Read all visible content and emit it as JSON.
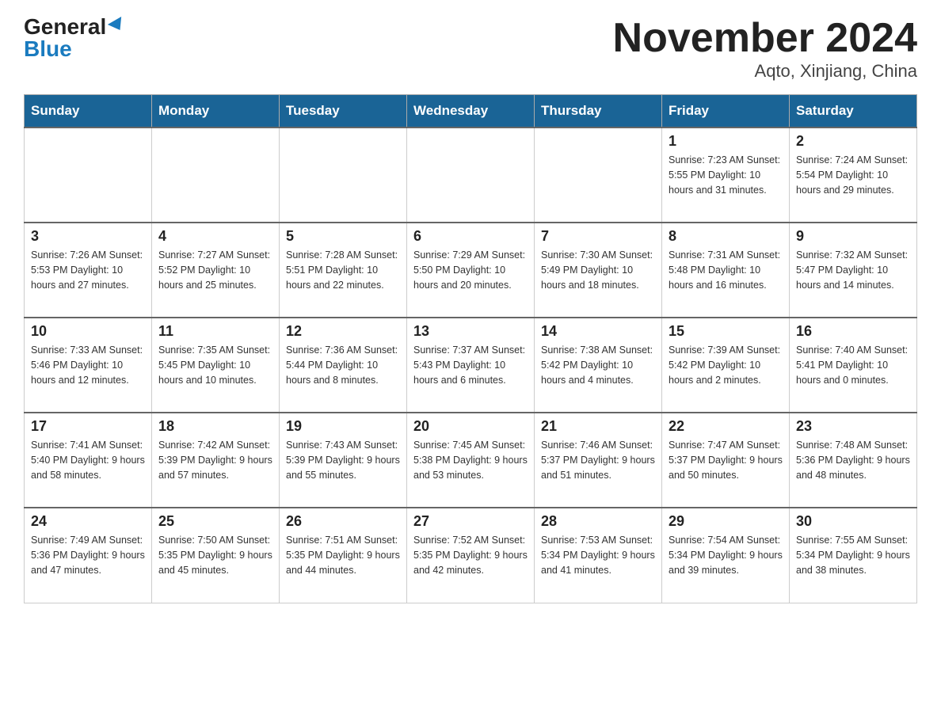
{
  "logo": {
    "general": "General",
    "blue": "Blue"
  },
  "title": "November 2024",
  "subtitle": "Aqto, Xinjiang, China",
  "days_of_week": [
    "Sunday",
    "Monday",
    "Tuesday",
    "Wednesday",
    "Thursday",
    "Friday",
    "Saturday"
  ],
  "weeks": [
    [
      {
        "day": "",
        "info": ""
      },
      {
        "day": "",
        "info": ""
      },
      {
        "day": "",
        "info": ""
      },
      {
        "day": "",
        "info": ""
      },
      {
        "day": "",
        "info": ""
      },
      {
        "day": "1",
        "info": "Sunrise: 7:23 AM\nSunset: 5:55 PM\nDaylight: 10 hours and 31 minutes."
      },
      {
        "day": "2",
        "info": "Sunrise: 7:24 AM\nSunset: 5:54 PM\nDaylight: 10 hours and 29 minutes."
      }
    ],
    [
      {
        "day": "3",
        "info": "Sunrise: 7:26 AM\nSunset: 5:53 PM\nDaylight: 10 hours and 27 minutes."
      },
      {
        "day": "4",
        "info": "Sunrise: 7:27 AM\nSunset: 5:52 PM\nDaylight: 10 hours and 25 minutes."
      },
      {
        "day": "5",
        "info": "Sunrise: 7:28 AM\nSunset: 5:51 PM\nDaylight: 10 hours and 22 minutes."
      },
      {
        "day": "6",
        "info": "Sunrise: 7:29 AM\nSunset: 5:50 PM\nDaylight: 10 hours and 20 minutes."
      },
      {
        "day": "7",
        "info": "Sunrise: 7:30 AM\nSunset: 5:49 PM\nDaylight: 10 hours and 18 minutes."
      },
      {
        "day": "8",
        "info": "Sunrise: 7:31 AM\nSunset: 5:48 PM\nDaylight: 10 hours and 16 minutes."
      },
      {
        "day": "9",
        "info": "Sunrise: 7:32 AM\nSunset: 5:47 PM\nDaylight: 10 hours and 14 minutes."
      }
    ],
    [
      {
        "day": "10",
        "info": "Sunrise: 7:33 AM\nSunset: 5:46 PM\nDaylight: 10 hours and 12 minutes."
      },
      {
        "day": "11",
        "info": "Sunrise: 7:35 AM\nSunset: 5:45 PM\nDaylight: 10 hours and 10 minutes."
      },
      {
        "day": "12",
        "info": "Sunrise: 7:36 AM\nSunset: 5:44 PM\nDaylight: 10 hours and 8 minutes."
      },
      {
        "day": "13",
        "info": "Sunrise: 7:37 AM\nSunset: 5:43 PM\nDaylight: 10 hours and 6 minutes."
      },
      {
        "day": "14",
        "info": "Sunrise: 7:38 AM\nSunset: 5:42 PM\nDaylight: 10 hours and 4 minutes."
      },
      {
        "day": "15",
        "info": "Sunrise: 7:39 AM\nSunset: 5:42 PM\nDaylight: 10 hours and 2 minutes."
      },
      {
        "day": "16",
        "info": "Sunrise: 7:40 AM\nSunset: 5:41 PM\nDaylight: 10 hours and 0 minutes."
      }
    ],
    [
      {
        "day": "17",
        "info": "Sunrise: 7:41 AM\nSunset: 5:40 PM\nDaylight: 9 hours and 58 minutes."
      },
      {
        "day": "18",
        "info": "Sunrise: 7:42 AM\nSunset: 5:39 PM\nDaylight: 9 hours and 57 minutes."
      },
      {
        "day": "19",
        "info": "Sunrise: 7:43 AM\nSunset: 5:39 PM\nDaylight: 9 hours and 55 minutes."
      },
      {
        "day": "20",
        "info": "Sunrise: 7:45 AM\nSunset: 5:38 PM\nDaylight: 9 hours and 53 minutes."
      },
      {
        "day": "21",
        "info": "Sunrise: 7:46 AM\nSunset: 5:37 PM\nDaylight: 9 hours and 51 minutes."
      },
      {
        "day": "22",
        "info": "Sunrise: 7:47 AM\nSunset: 5:37 PM\nDaylight: 9 hours and 50 minutes."
      },
      {
        "day": "23",
        "info": "Sunrise: 7:48 AM\nSunset: 5:36 PM\nDaylight: 9 hours and 48 minutes."
      }
    ],
    [
      {
        "day": "24",
        "info": "Sunrise: 7:49 AM\nSunset: 5:36 PM\nDaylight: 9 hours and 47 minutes."
      },
      {
        "day": "25",
        "info": "Sunrise: 7:50 AM\nSunset: 5:35 PM\nDaylight: 9 hours and 45 minutes."
      },
      {
        "day": "26",
        "info": "Sunrise: 7:51 AM\nSunset: 5:35 PM\nDaylight: 9 hours and 44 minutes."
      },
      {
        "day": "27",
        "info": "Sunrise: 7:52 AM\nSunset: 5:35 PM\nDaylight: 9 hours and 42 minutes."
      },
      {
        "day": "28",
        "info": "Sunrise: 7:53 AM\nSunset: 5:34 PM\nDaylight: 9 hours and 41 minutes."
      },
      {
        "day": "29",
        "info": "Sunrise: 7:54 AM\nSunset: 5:34 PM\nDaylight: 9 hours and 39 minutes."
      },
      {
        "day": "30",
        "info": "Sunrise: 7:55 AM\nSunset: 5:34 PM\nDaylight: 9 hours and 38 minutes."
      }
    ]
  ]
}
